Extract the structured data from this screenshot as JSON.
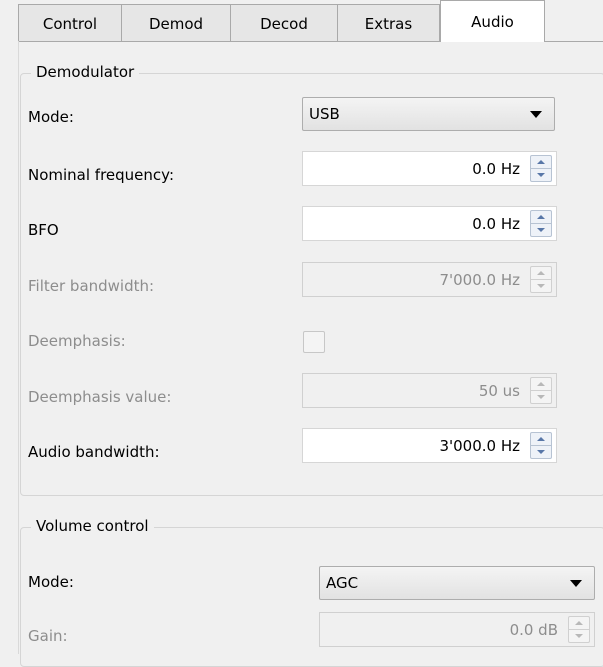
{
  "tabs": [
    {
      "label": "Control"
    },
    {
      "label": "Demod"
    },
    {
      "label": "Decod"
    },
    {
      "label": "Extras"
    },
    {
      "label": "Audio"
    }
  ],
  "demodulator": {
    "title": "Demodulator",
    "mode": {
      "label": "Mode:",
      "value": "USB"
    },
    "nominal_frequency": {
      "label": "Nominal frequency:",
      "value": "0.0 Hz"
    },
    "bfo": {
      "label": "BFO",
      "value": "0.0 Hz"
    },
    "filter_bandwidth": {
      "label": "Filter bandwidth:",
      "value": "7'000.0 Hz"
    },
    "deemphasis": {
      "label": "Deemphasis:",
      "checked": false
    },
    "deemphasis_value": {
      "label": "Deemphasis value:",
      "value": "50 us"
    },
    "audio_bandwidth": {
      "label": "Audio bandwidth:",
      "value": "3'000.0 Hz"
    }
  },
  "volume": {
    "title": "Volume control",
    "mode": {
      "label": "Mode:",
      "value": "AGC"
    },
    "gain": {
      "label": "Gain:",
      "value": "0.0 dB"
    }
  }
}
